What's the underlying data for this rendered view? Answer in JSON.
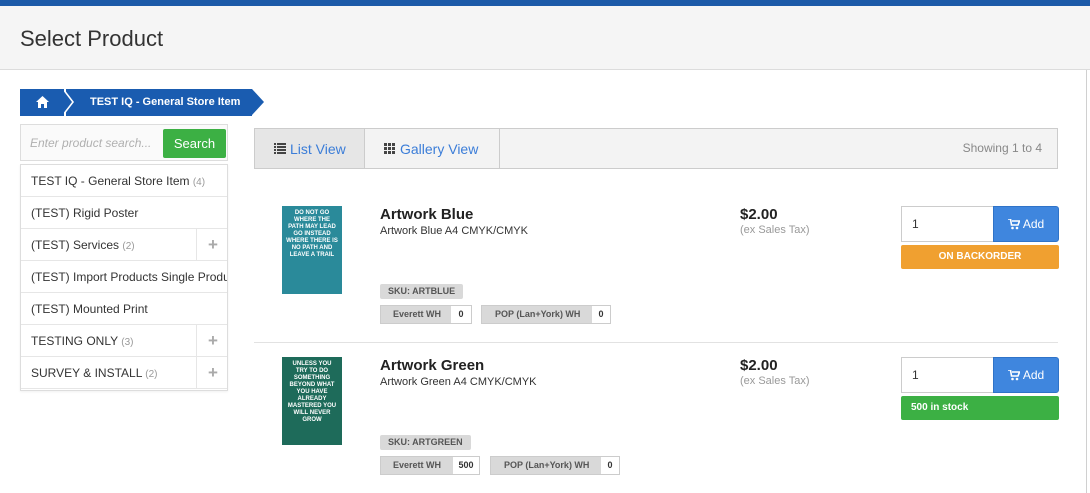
{
  "header": {
    "title": "Select Product"
  },
  "breadcrumb": {
    "home_icon": "home-icon",
    "current": "TEST IQ - General Store Item"
  },
  "search": {
    "placeholder": "Enter product search...",
    "button_label": "Search"
  },
  "categories": [
    {
      "label": "TEST IQ - General Store Item",
      "count": "(4)",
      "expandable": false
    },
    {
      "label": "(TEST) Rigid Poster",
      "count": "",
      "expandable": false
    },
    {
      "label": "(TEST) Services",
      "count": "(2)",
      "expandable": true
    },
    {
      "label": "(TEST) Import Products Single Product",
      "count": "",
      "expandable": false
    },
    {
      "label": "(TEST) Mounted Print",
      "count": "",
      "expandable": false
    },
    {
      "label": "TESTING ONLY",
      "count": "(3)",
      "expandable": true
    },
    {
      "label": "SURVEY & INSTALL",
      "count": "(2)",
      "expandable": true
    }
  ],
  "category_expand_icon": "+",
  "views": {
    "list_label": "List View",
    "gallery_label": "Gallery View",
    "showing": "Showing 1 to 4"
  },
  "products": [
    {
      "name": "Artwork Blue",
      "description": "Artwork Blue A4 CMYK/CMYK",
      "price": "$2.00",
      "tax_note": "(ex Sales Tax)",
      "quantity": "1",
      "add_label": "Add",
      "status": "ON BACKORDER",
      "status_color": "#f0a030",
      "sku": "SKU: ARTBLUE",
      "warehouses": [
        {
          "name": "Everett WH",
          "qty": "0"
        },
        {
          "name": "POP (Lan+York) WH",
          "qty": "0"
        }
      ],
      "thumb_text": "DO NOT GO WHERE THE PATH MAY LEAD GO INSTEAD WHERE THERE IS NO PATH AND LEAVE A TRAIL",
      "thumb_color": "#2a8a9a"
    },
    {
      "name": "Artwork Green",
      "description": "Artwork Green A4 CMYK/CMYK",
      "price": "$2.00",
      "tax_note": "(ex Sales Tax)",
      "quantity": "1",
      "add_label": "Add",
      "status": "500 in stock",
      "status_color": "#3cb044",
      "sku": "SKU: ARTGREEN",
      "warehouses": [
        {
          "name": "Everett WH",
          "qty": "500"
        },
        {
          "name": "POP (Lan+York) WH",
          "qty": "0"
        }
      ],
      "thumb_text": "UNLESS YOU TRY TO DO SOMETHING BEYOND WHAT YOU HAVE ALREADY MASTERED YOU WILL NEVER GROW",
      "thumb_color": "#1e6b5a"
    }
  ]
}
